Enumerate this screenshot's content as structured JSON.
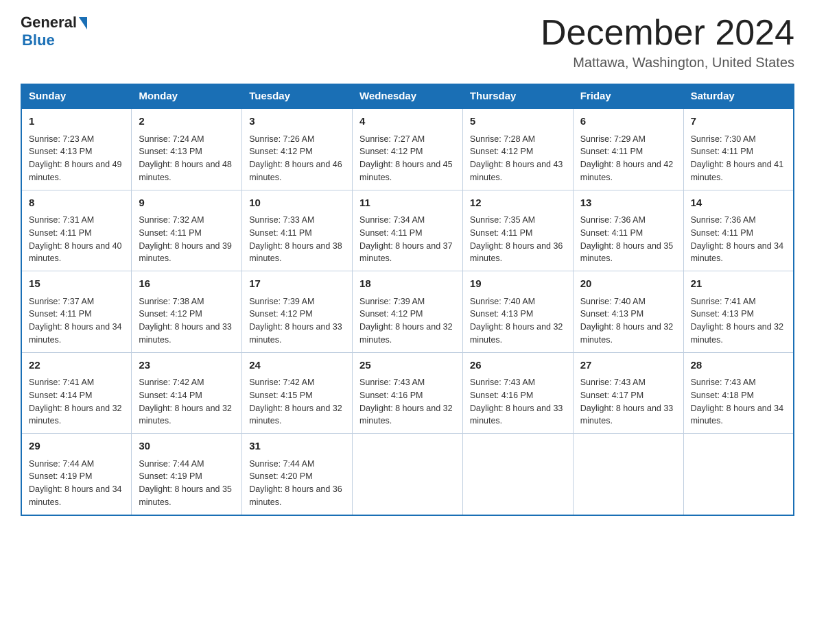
{
  "header": {
    "title": "December 2024",
    "location": "Mattawa, Washington, United States",
    "logo_general": "General",
    "logo_blue": "Blue"
  },
  "days_of_week": [
    "Sunday",
    "Monday",
    "Tuesday",
    "Wednesday",
    "Thursday",
    "Friday",
    "Saturday"
  ],
  "weeks": [
    [
      {
        "num": "1",
        "sunrise": "7:23 AM",
        "sunset": "4:13 PM",
        "daylight": "8 hours and 49 minutes."
      },
      {
        "num": "2",
        "sunrise": "7:24 AM",
        "sunset": "4:13 PM",
        "daylight": "8 hours and 48 minutes."
      },
      {
        "num": "3",
        "sunrise": "7:26 AM",
        "sunset": "4:12 PM",
        "daylight": "8 hours and 46 minutes."
      },
      {
        "num": "4",
        "sunrise": "7:27 AM",
        "sunset": "4:12 PM",
        "daylight": "8 hours and 45 minutes."
      },
      {
        "num": "5",
        "sunrise": "7:28 AM",
        "sunset": "4:12 PM",
        "daylight": "8 hours and 43 minutes."
      },
      {
        "num": "6",
        "sunrise": "7:29 AM",
        "sunset": "4:11 PM",
        "daylight": "8 hours and 42 minutes."
      },
      {
        "num": "7",
        "sunrise": "7:30 AM",
        "sunset": "4:11 PM",
        "daylight": "8 hours and 41 minutes."
      }
    ],
    [
      {
        "num": "8",
        "sunrise": "7:31 AM",
        "sunset": "4:11 PM",
        "daylight": "8 hours and 40 minutes."
      },
      {
        "num": "9",
        "sunrise": "7:32 AM",
        "sunset": "4:11 PM",
        "daylight": "8 hours and 39 minutes."
      },
      {
        "num": "10",
        "sunrise": "7:33 AM",
        "sunset": "4:11 PM",
        "daylight": "8 hours and 38 minutes."
      },
      {
        "num": "11",
        "sunrise": "7:34 AM",
        "sunset": "4:11 PM",
        "daylight": "8 hours and 37 minutes."
      },
      {
        "num": "12",
        "sunrise": "7:35 AM",
        "sunset": "4:11 PM",
        "daylight": "8 hours and 36 minutes."
      },
      {
        "num": "13",
        "sunrise": "7:36 AM",
        "sunset": "4:11 PM",
        "daylight": "8 hours and 35 minutes."
      },
      {
        "num": "14",
        "sunrise": "7:36 AM",
        "sunset": "4:11 PM",
        "daylight": "8 hours and 34 minutes."
      }
    ],
    [
      {
        "num": "15",
        "sunrise": "7:37 AM",
        "sunset": "4:11 PM",
        "daylight": "8 hours and 34 minutes."
      },
      {
        "num": "16",
        "sunrise": "7:38 AM",
        "sunset": "4:12 PM",
        "daylight": "8 hours and 33 minutes."
      },
      {
        "num": "17",
        "sunrise": "7:39 AM",
        "sunset": "4:12 PM",
        "daylight": "8 hours and 33 minutes."
      },
      {
        "num": "18",
        "sunrise": "7:39 AM",
        "sunset": "4:12 PM",
        "daylight": "8 hours and 32 minutes."
      },
      {
        "num": "19",
        "sunrise": "7:40 AM",
        "sunset": "4:13 PM",
        "daylight": "8 hours and 32 minutes."
      },
      {
        "num": "20",
        "sunrise": "7:40 AM",
        "sunset": "4:13 PM",
        "daylight": "8 hours and 32 minutes."
      },
      {
        "num": "21",
        "sunrise": "7:41 AM",
        "sunset": "4:13 PM",
        "daylight": "8 hours and 32 minutes."
      }
    ],
    [
      {
        "num": "22",
        "sunrise": "7:41 AM",
        "sunset": "4:14 PM",
        "daylight": "8 hours and 32 minutes."
      },
      {
        "num": "23",
        "sunrise": "7:42 AM",
        "sunset": "4:14 PM",
        "daylight": "8 hours and 32 minutes."
      },
      {
        "num": "24",
        "sunrise": "7:42 AM",
        "sunset": "4:15 PM",
        "daylight": "8 hours and 32 minutes."
      },
      {
        "num": "25",
        "sunrise": "7:43 AM",
        "sunset": "4:16 PM",
        "daylight": "8 hours and 32 minutes."
      },
      {
        "num": "26",
        "sunrise": "7:43 AM",
        "sunset": "4:16 PM",
        "daylight": "8 hours and 33 minutes."
      },
      {
        "num": "27",
        "sunrise": "7:43 AM",
        "sunset": "4:17 PM",
        "daylight": "8 hours and 33 minutes."
      },
      {
        "num": "28",
        "sunrise": "7:43 AM",
        "sunset": "4:18 PM",
        "daylight": "8 hours and 34 minutes."
      }
    ],
    [
      {
        "num": "29",
        "sunrise": "7:44 AM",
        "sunset": "4:19 PM",
        "daylight": "8 hours and 34 minutes."
      },
      {
        "num": "30",
        "sunrise": "7:44 AM",
        "sunset": "4:19 PM",
        "daylight": "8 hours and 35 minutes."
      },
      {
        "num": "31",
        "sunrise": "7:44 AM",
        "sunset": "4:20 PM",
        "daylight": "8 hours and 36 minutes."
      },
      null,
      null,
      null,
      null
    ]
  ],
  "labels": {
    "sunrise": "Sunrise:",
    "sunset": "Sunset:",
    "daylight": "Daylight:"
  }
}
